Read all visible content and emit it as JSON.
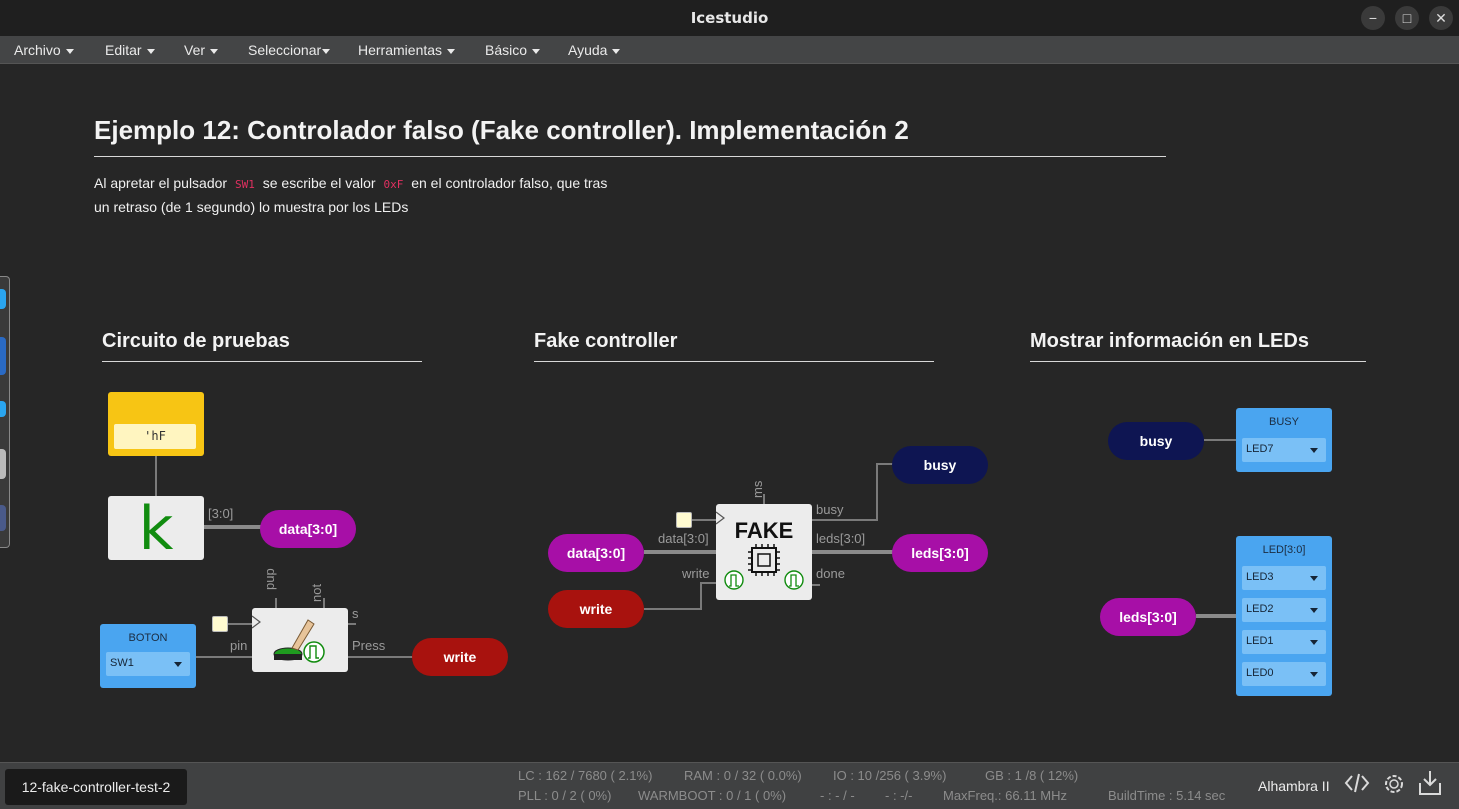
{
  "window": {
    "title": "Icestudio",
    "minimize": "−",
    "maximize": "□",
    "close": "✕"
  },
  "menubar": {
    "items": [
      "Archivo",
      "Editar",
      "Ver",
      "Seleccionar",
      "Herramientas",
      "Básico",
      "Ayuda"
    ]
  },
  "header": {
    "title": "Ejemplo 12: Controlador falso (Fake controller). Implementación 2",
    "desc_part1": "Al apretar el pulsador",
    "code1": "SW1",
    "desc_part2": "se escribe el valor",
    "code2": "0xF",
    "desc_part3": "en el controlador falso, que tras",
    "desc_line2": "un retraso (de 1 segundo) lo muestra por los LEDs"
  },
  "sections": {
    "test": {
      "title": "Circuito de pruebas",
      "constant_value": "'hF",
      "constant_symbol": "k",
      "bus_label": "[3:0]",
      "data_label": "data[3:0]",
      "button_header": "BOTON",
      "button_select": "SW1",
      "block_ports": {
        "pup": "pup",
        "not": "not",
        "s": "s",
        "pin": "pin",
        "press": "Press"
      },
      "write_label": "write"
    },
    "fake": {
      "title": "Fake controller",
      "data_in": "data[3:0]",
      "write_in": "write",
      "block_title": "FAKE",
      "ports": {
        "ms": "ms",
        "data": "data[3:0]",
        "write": "write",
        "busy": "busy",
        "leds": "leds[3:0]",
        "done": "done"
      },
      "busy_out": "busy",
      "leds_out": "leds[3:0]"
    },
    "leds": {
      "title": "Mostrar información en LEDs",
      "busy_in": "busy",
      "busy_header": "BUSY",
      "busy_led": "LED7",
      "leds_in": "leds[3:0]",
      "leds_header": "LED[3:0]",
      "leds_list": [
        "LED3",
        "LED2",
        "LED1",
        "LED0"
      ]
    }
  },
  "statusbar": {
    "file_tab": "12-fake-controller-test-2",
    "lc": "LC : 162 / 7680 ( 2.1%)",
    "ram": "RAM : 0 / 32 ( 0.0%)",
    "io": "IO :  10 /256  ( 3.9%)",
    "gb": "GB :  1 /8  ( 12%)",
    "pll": "PLL : 0 / 2 ( 0%)",
    "warmboot": "WARMBOOT : 0 / 1 ( 0%)",
    "dash1": "- : - / -",
    "dash2": "- :  -/-",
    "maxfreq": "MaxFreq.:  66.11 MHz",
    "buildtime": "BuildTime :  5.14 sec",
    "board": "Alhambra II"
  },
  "colors": {
    "purple": "#a70fa7",
    "red": "#a8120e",
    "navy": "#0e1552",
    "blue": "#4aa5f0",
    "yellow": "#f7c514",
    "green": "#118c0f"
  }
}
